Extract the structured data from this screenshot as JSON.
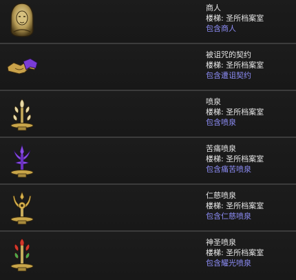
{
  "rows": [
    {
      "name": "商人",
      "floor_label": "楼梯:",
      "floor_value": "圣所档案室",
      "contains": "包含商人",
      "icon": "merchant-icon"
    },
    {
      "name": "被诅咒的契约",
      "floor_label": "楼梯:",
      "floor_value": "圣所档案室",
      "contains": "包含遭诅契约",
      "icon": "cursed-pact-icon"
    },
    {
      "name": "喷泉",
      "floor_label": "楼梯:",
      "floor_value": "圣所档案室",
      "contains": "包含喷泉",
      "icon": "fountain-icon"
    },
    {
      "name": "苦痛喷泉",
      "floor_label": "楼梯:",
      "floor_value": "圣所档案室",
      "contains": "包含痛苦喷泉",
      "icon": "fountain-of-pain-icon"
    },
    {
      "name": "仁慈喷泉",
      "floor_label": "楼梯:",
      "floor_value": "圣所档案室",
      "contains": "包含仁慈喷泉",
      "icon": "fountain-of-mercy-icon"
    },
    {
      "name": "神圣喷泉",
      "floor_label": "楼梯:",
      "floor_value": "圣所档案室",
      "contains": "包含耀光喷泉",
      "icon": "holy-fountain-icon"
    }
  ],
  "colors": {
    "link": "#8c8cf5",
    "gold": "#c9a64a",
    "purple": "#7a3cd6"
  }
}
